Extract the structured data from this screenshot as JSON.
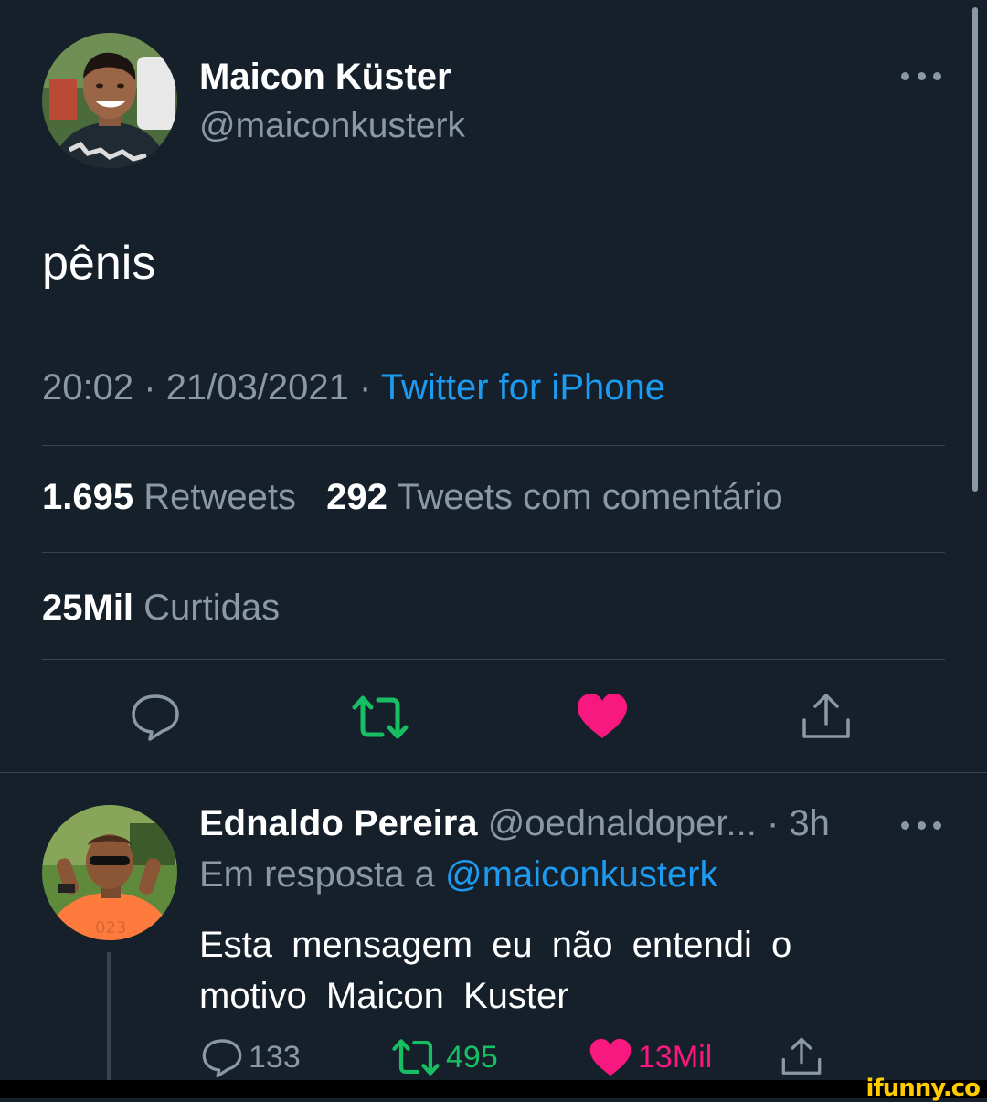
{
  "tweet": {
    "author": {
      "name": "Maicon Küster",
      "handle": "@maiconkusterk"
    },
    "text": "pênis",
    "time": "20:02",
    "date": "21/03/2021",
    "separator": "·",
    "source": "Twitter for iPhone",
    "stats": {
      "retweets_count": "1.695",
      "retweets_label": "Retweets",
      "quotes_count": "292",
      "quotes_label": "Tweets com comentário",
      "likes_count": "25Mil",
      "likes_label": "Curtidas"
    },
    "actions": {
      "reply_icon": "speech-bubble-icon",
      "retweet_icon": "retweet-arrows-icon",
      "like_icon": "heart-icon",
      "share_icon": "share-upload-icon",
      "retweet_color": "#17bf63",
      "like_color": "#f91880"
    }
  },
  "reply": {
    "author": {
      "name": "Ednaldo Pereira",
      "handle": "@oednaldoper...",
      "time": "· 3h"
    },
    "in_reply_to_label": "Em resposta a",
    "in_reply_to_handle": "@maiconkusterk",
    "text": "Esta mensagem eu não entendi o motivo Maicon Kuster",
    "actions": {
      "reply_count": "133",
      "retweet_count": "495",
      "like_count": "13Mil"
    }
  },
  "watermark": "ifunny.co",
  "theme": {
    "background": "#15202b",
    "secondary_text": "#8b98a5",
    "link": "#1d9bf0",
    "border": "#38444d"
  }
}
